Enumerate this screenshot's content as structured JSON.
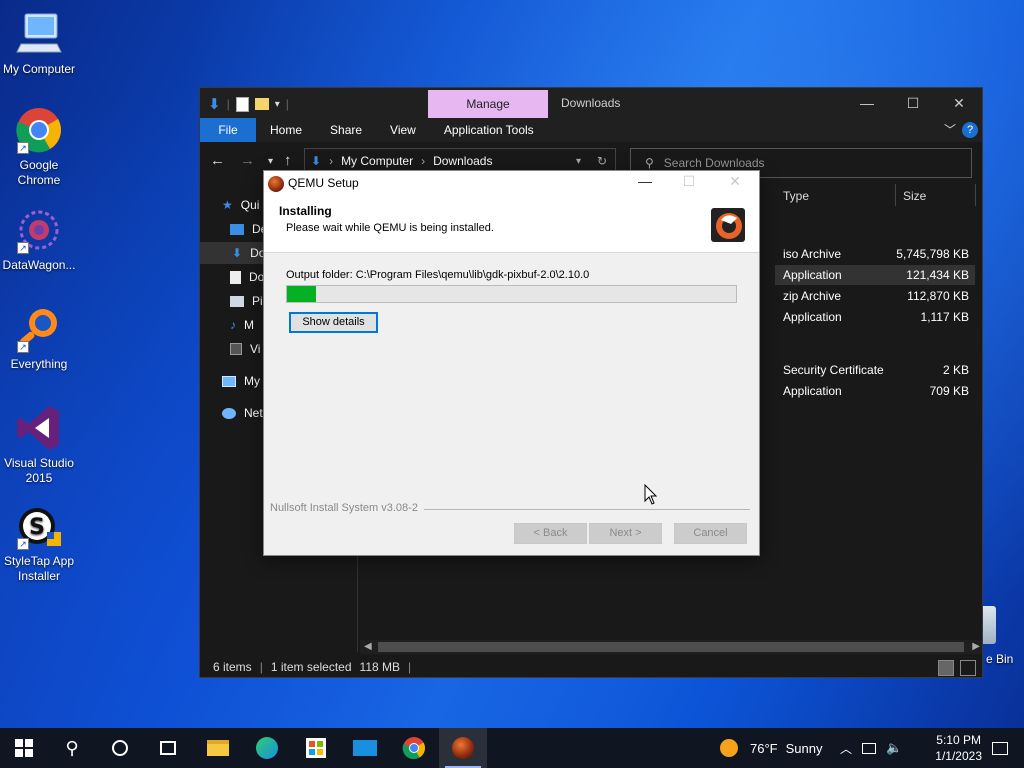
{
  "desktop": {
    "icons": [
      {
        "label": "My Computer"
      },
      {
        "label": "Google\nChrome"
      },
      {
        "label": "DataWagon..."
      },
      {
        "label": "Everything"
      },
      {
        "label": "Visual Studio\n2015"
      },
      {
        "label": "StyleTap App\nInstaller"
      }
    ],
    "recycle_bin_label": "e Bin"
  },
  "explorer": {
    "manage_tab": "Manage",
    "title": "Downloads",
    "ribbon": {
      "file": "File",
      "tabs": [
        "Home",
        "Share",
        "View",
        "Application Tools"
      ]
    },
    "address": {
      "root": "My Computer",
      "folder": "Downloads"
    },
    "search_placeholder": "Search Downloads",
    "nav_items": [
      "Qui",
      "De",
      "Do",
      "Do",
      "Pi",
      "M",
      "Vi",
      "My",
      "Net"
    ],
    "columns": {
      "type": "Type",
      "size": "Size"
    },
    "rows": [
      {
        "type": "iso Archive",
        "size": "5,745,798 KB",
        "selected": false
      },
      {
        "type": "Application",
        "size": "121,434 KB",
        "selected": true
      },
      {
        "type": "zip Archive",
        "size": "112,870 KB",
        "selected": false
      },
      {
        "type": "Application",
        "size": "1,117 KB",
        "selected": false
      },
      {
        "type": "Security Certificate",
        "size": "2 KB",
        "selected": false
      },
      {
        "type": "Application",
        "size": "709 KB",
        "selected": false
      }
    ],
    "status": {
      "items": "6 items",
      "selected": "1 item selected",
      "size": "118 MB"
    }
  },
  "installer": {
    "title": "QEMU Setup",
    "heading": "Installing",
    "subheading": "Please wait while QEMU is being installed.",
    "output_folder": "Output folder: C:\\Program Files\\qemu\\lib\\gdk-pixbuf-2.0\\2.10.0",
    "progress_fraction": 0.065,
    "show_details": "Show details",
    "branding": "Nullsoft Install System v3.08-2",
    "back": "< Back",
    "next": "Next >",
    "cancel": "Cancel"
  },
  "taskbar": {
    "weather": {
      "temp": "76°F",
      "condition": "Sunny"
    },
    "time": "5:10 PM",
    "date": "1/1/2023"
  },
  "colors": {
    "accent": "#0078d7",
    "progress": "#06b025",
    "manage_tab": "#e6b7f0"
  }
}
